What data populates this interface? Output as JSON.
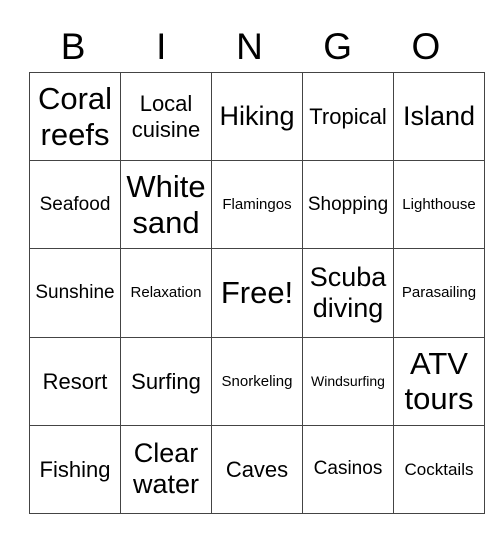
{
  "header": {
    "letters": [
      "B",
      "I",
      "N",
      "G",
      "O"
    ]
  },
  "board": {
    "rows": [
      [
        "Coral reefs",
        "Local cuisine",
        "Hiking",
        "Tropical",
        "Island"
      ],
      [
        "Seafood",
        "White sand",
        "Flamingos",
        "Shopping",
        "Lighthouse"
      ],
      [
        "Sunshine",
        "Relaxation",
        "Free!",
        "Scuba diving",
        "Parasailing"
      ],
      [
        "Resort",
        "Surfing",
        "Snorkeling",
        "Windsurfing",
        "ATV tours"
      ],
      [
        "Fishing",
        "Clear water",
        "Caves",
        "Casinos",
        "Cocktails"
      ]
    ],
    "free_space": "Free!"
  },
  "colors": {
    "background": "#ffffff",
    "text": "#000000",
    "grid_lines": "#444444"
  }
}
